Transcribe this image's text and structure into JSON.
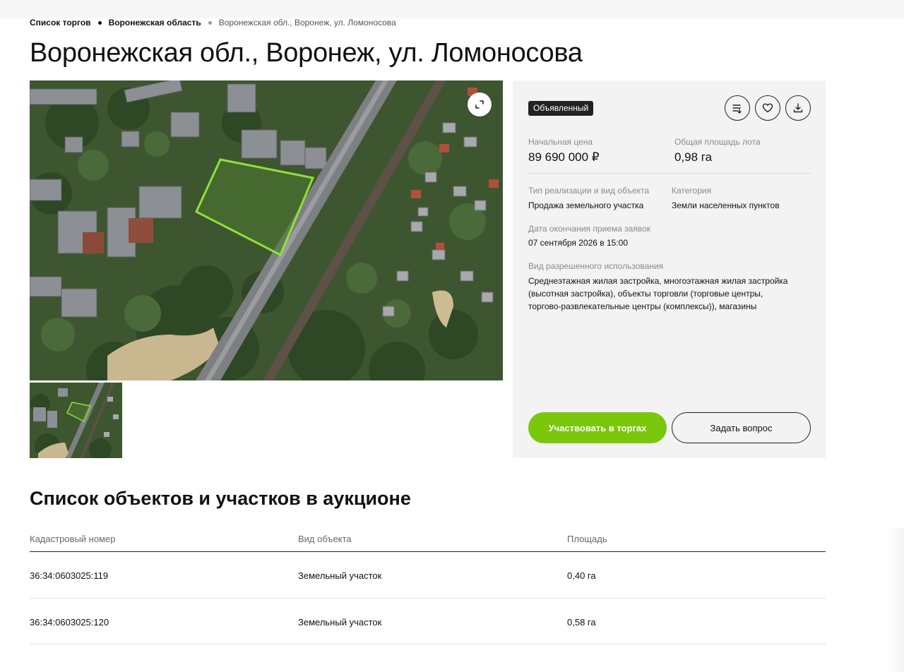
{
  "breadcrumb": [
    {
      "label": "Список торгов"
    },
    {
      "label": "Воронежская область"
    },
    {
      "label": "Воронежская обл., Воронеж, ул. Ломоносова"
    }
  ],
  "page_title": "Воронежская обл., Воронеж, ул. Ломоносова",
  "gallery": {
    "expand_icon": "expand-icon",
    "thumbnail_count": 1
  },
  "panel": {
    "status": "Объявленный",
    "actions": [
      {
        "icon": "list-compare-icon"
      },
      {
        "icon": "heart-icon"
      },
      {
        "icon": "download-icon"
      }
    ],
    "price_label": "Начальная цена",
    "price_value": "89 690 000 ₽",
    "area_label": "Общая площадь лота",
    "area_value": "0,98 га",
    "type_label": "Тип реализации и вид объекта",
    "type_value": "Продажа земельного участка",
    "category_label": "Категория",
    "category_value": "Земли населенных пунктов",
    "deadline_label": "Дата окончания приема заявок",
    "deadline_value": "07 сентября 2026 в 15:00",
    "usage_label": "Вид разрешенного использования",
    "usage_value": "Среднеэтажная жилая застройка, многоэтажная жилая застройка (высотная застройка), объекты торговли (торговые центры, торгово-развлекательные центры (комплексы)), магазины",
    "participate_label": "Участвовать в торгах",
    "ask_label": "Задать вопрос"
  },
  "colors": {
    "accent_green": "#7ac70c",
    "badge_bg": "#222222",
    "panel_bg": "#f3f3f3",
    "plot_outline": "#8fe03a"
  },
  "objects": {
    "title": "Список объектов и участков в аукционе",
    "columns": [
      "Кадастровый номер",
      "Вид объекта",
      "Площадь"
    ],
    "rows": [
      [
        "36:34:0603025:119",
        "Земельный участок",
        "0,40 га"
      ],
      [
        "36:34:0603025:120",
        "Земельный участок",
        "0,58 га"
      ]
    ]
  }
}
